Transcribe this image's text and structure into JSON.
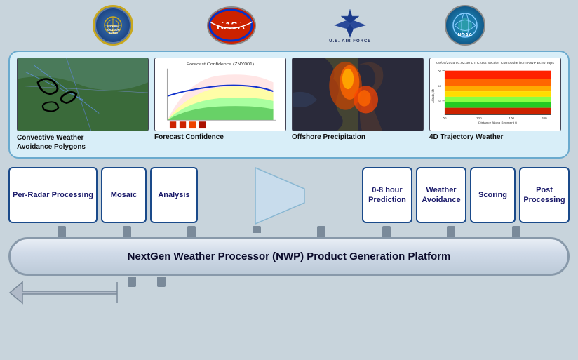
{
  "logos": [
    {
      "id": "faa",
      "label": "FEDERAL AVIATION\nADMINISTRATION",
      "class": "logo-faa"
    },
    {
      "id": "nasa",
      "label": "NASA",
      "class": "logo-nasa"
    },
    {
      "id": "usaf",
      "label": "U.S. AIR FORCE",
      "class": "logo-usaf"
    },
    {
      "id": "noaa",
      "label": "NOAA",
      "class": "logo-noaa"
    }
  ],
  "weather_products": [
    {
      "id": "convective",
      "label": "Convective Weather\nAvoidance Polygons",
      "img_class": "img-convective"
    },
    {
      "id": "forecast",
      "label": "Forecast Confidence",
      "img_class": "img-forecast"
    },
    {
      "id": "offshore",
      "label": "Offshore Precipitation",
      "img_class": "img-offshore"
    },
    {
      "id": "trajectory",
      "label": "4D Trajectory Weather",
      "img_class": "img-4d"
    }
  ],
  "pipeline": {
    "left_boxes": [
      {
        "id": "per-radar",
        "label": "Per-Radar\nProcessing"
      },
      {
        "id": "mosaic",
        "label": "Mosaic"
      },
      {
        "id": "analysis",
        "label": "Analysis"
      }
    ],
    "right_boxes": [
      {
        "id": "prediction",
        "label": "0-8 hour\nPrediction"
      },
      {
        "id": "weather-avoidance",
        "label": "Weather\nAvoidance"
      },
      {
        "id": "scoring",
        "label": "Scoring"
      },
      {
        "id": "post-processing",
        "label": "Post\nProcessing"
      }
    ]
  },
  "platform": {
    "label": "NextGen Weather Processor (NWP) Product Generation Platform"
  }
}
